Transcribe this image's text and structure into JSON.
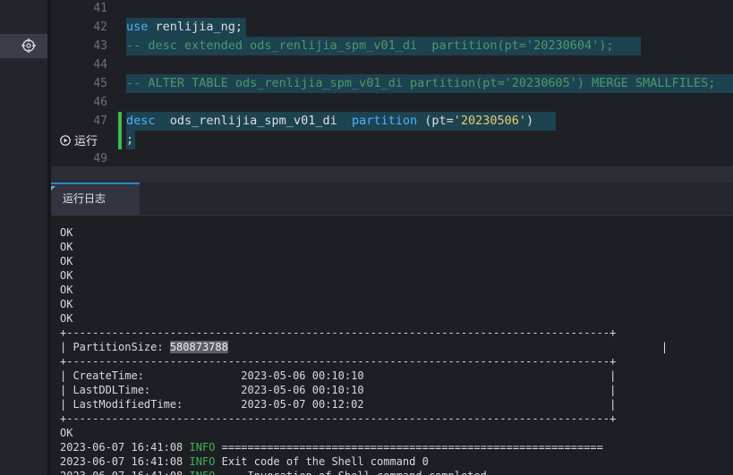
{
  "sidebar": {
    "active_icon": "target-icon"
  },
  "editor": {
    "lines": [
      {
        "n": "41",
        "segments": []
      },
      {
        "n": "42",
        "segments": [
          {
            "t": "use",
            "c": "kw"
          },
          {
            "t": " renlijia_ng;",
            "c": ""
          }
        ]
      },
      {
        "n": "43",
        "segments": [
          {
            "t": "-- desc extended ods_renlijia_spm_v01_di  partition(pt='20230604');",
            "c": "cm"
          }
        ]
      },
      {
        "n": "44",
        "segments": []
      },
      {
        "n": "45",
        "segments": [
          {
            "t": "-- ALTER TABLE ods_renlijia_spm_v01_di partition(pt='20230605') MERGE SMALLFILES;",
            "c": "cm"
          }
        ]
      },
      {
        "n": "46",
        "segments": []
      },
      {
        "n": "47",
        "segments": [
          {
            "t": "desc",
            "c": "kw"
          },
          {
            "t": "  ods_renlijia_spm_v01_di  ",
            "c": ""
          },
          {
            "t": "partition",
            "c": "kw"
          },
          {
            "t": " (pt=",
            "c": ""
          },
          {
            "t": "'20230506'",
            "c": "str"
          },
          {
            "t": ")",
            "c": ""
          }
        ]
      },
      {
        "n": "48",
        "segments": [
          {
            "t": ";",
            "c": ""
          }
        ]
      },
      {
        "n": "49",
        "segments": []
      }
    ],
    "run_label": "运行"
  },
  "log_panel": {
    "tab_label": "运行日志",
    "lines": [
      {
        "text": "OK"
      },
      {
        "text": "OK"
      },
      {
        "text": "OK"
      },
      {
        "text": "OK"
      },
      {
        "text": "OK"
      },
      {
        "text": "OK"
      },
      {
        "text": "OK"
      },
      {
        "text": "+------------------------------------------------------------------------------------+"
      },
      {
        "prefix": "| PartitionSize: ",
        "sel": "580873788",
        "suffix": "                                                                   |"
      },
      {
        "text": "+------------------------------------------------------------------------------------+"
      },
      {
        "text": "| CreateTime:               2023-05-06 00:10:10                                      |"
      },
      {
        "text": "| LastDDLTime:              2023-05-06 00:10:10                                      |"
      },
      {
        "text": "| LastModifiedTime:         2023-05-07 00:12:02                                      |"
      },
      {
        "text": "+------------------------------------------------------------------------------------+"
      },
      {
        "text": "OK"
      },
      {
        "ts": "2023-06-07 16:41:08 ",
        "level": "INFO",
        "msg": " ==========================================================="
      },
      {
        "ts": "2023-06-07 16:41:08 ",
        "level": "INFO",
        "msg": " Exit code of the Shell command 0"
      },
      {
        "ts": "2023-06-07 16:41:08 ",
        "level": "INFO",
        "msg": " --- Invocation of Shell command completed ---"
      }
    ]
  }
}
